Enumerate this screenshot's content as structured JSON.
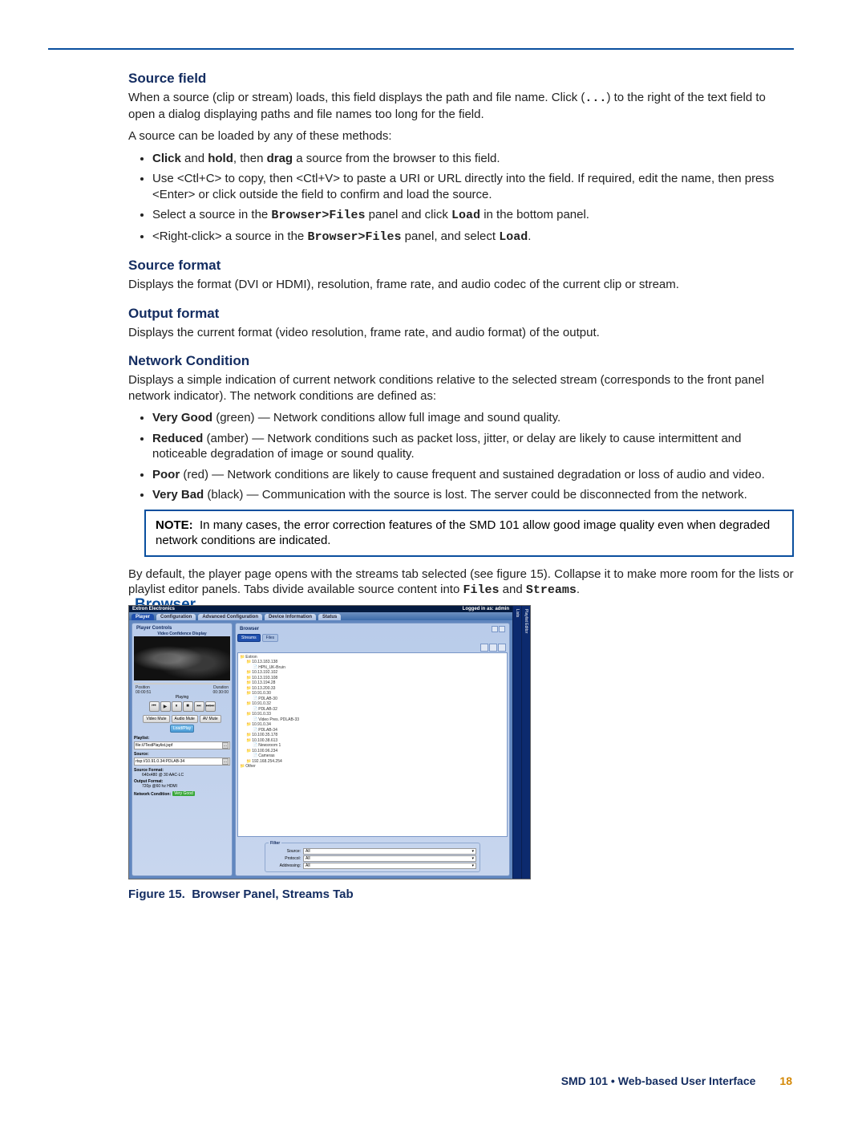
{
  "sections": {
    "source_field": {
      "title": "Source field",
      "p1a": "When a source (clip or stream) loads, this field displays the path and file name. Click (",
      "p1b": ") to the right of the text field to open a dialog displaying paths and file names too long for the field.",
      "dots": "...",
      "p2": "A source can be loaded by any of these methods:",
      "bullets": [
        {
          "b1": "Click",
          "mid1": " and ",
          "b2": "hold",
          "mid2": ", then ",
          "b3": "drag",
          "rest": " a source from the browser to this field."
        },
        {
          "text": "Use <Ctl+C> to copy, then <Ctl+V> to paste a URI or URL directly into the field. If required, edit the name, then press <Enter> or click outside the field to confirm and load the source."
        },
        {
          "pre": "Select a source in the ",
          "code": "Browser>Files",
          "mid": " panel and click ",
          "code2": "Load",
          "post": " in the bottom panel."
        },
        {
          "pre": "<Right-click> a source in the ",
          "code": "Browser>Files",
          "mid": " panel, and select ",
          "code2": "Load",
          "post": "."
        }
      ]
    },
    "source_format": {
      "title": "Source format",
      "body": "Displays the format (DVI or HDMI), resolution, frame rate, and audio codec of the current clip or stream."
    },
    "output_format": {
      "title": "Output format",
      "body": "Displays the current format (video resolution, frame rate, and audio format) of the output."
    },
    "network_condition": {
      "title": "Network Condition",
      "body": "Displays a simple indication of current network conditions relative to the selected stream (corresponds to the front panel network indicator). The network conditions are defined as:",
      "bullets": [
        {
          "b": "Very Good",
          "rest": " (green) — Network conditions allow full image and sound quality."
        },
        {
          "b": "Reduced",
          "rest": " (amber) — Network conditions such as packet loss, jitter, or delay are likely to cause intermittent and noticeable degradation of image or sound quality."
        },
        {
          "b": "Poor",
          "rest": " (red) — Network conditions are likely to cause frequent and sustained degradation or loss of audio and video."
        },
        {
          "b": "Very Bad",
          "rest": " (black) — Communication with the source is lost. The server could be disconnected from the network."
        }
      ],
      "note_label": "NOTE:",
      "note_body": "In many cases, the error correction features of the SMD 101 allow good image quality even when degraded network conditions are indicated."
    },
    "browser": {
      "title": "Browser",
      "p_pre": "By default, the player page opens with the streams tab selected (see figure 15). Collapse it to make more room for the lists or playlist editor panels. Tabs divide available source content into ",
      "code1": "Files",
      "and": " and ",
      "code2": "Streams",
      "post": "."
    }
  },
  "figure": {
    "caption_num": "Figure 15.",
    "caption_text": "Browser Panel, Streams Tab"
  },
  "footer": {
    "text": "SMD 101 • Web-based User Interface",
    "page": "18"
  },
  "screenshot": {
    "brand": "Extron Electronics",
    "login": "Logged in as: admin",
    "tabs": [
      "Player",
      "Configuration",
      "Advanced Configuration",
      "Device Information",
      "Status"
    ],
    "active_tab": "Player",
    "left": {
      "title": "Player Controls",
      "subtitle": "Video Confidence Display",
      "position_label": "Position",
      "position": "00:00:51",
      "duration_label": "Duration",
      "duration": "00:30:00",
      "status": "Playing",
      "controls": [
        "⏮",
        "▶",
        "⏸",
        "■",
        "⏭",
        "⏭⏭"
      ],
      "btn_video_mute": "Video Mute",
      "btn_audio_mute": "Audio Mute",
      "btn_av_mute": "AV Mute",
      "btn_load_play": "Load/Play",
      "playlist_label": "Playlist:",
      "playlist_value": "file:///TestPlaylist.jspf",
      "source_label": "Source:",
      "source_value": "rtsp://10.91.0.34:PDLAB-34",
      "source_format_label": "Source Format:",
      "source_format_value": "640x480 @ 30 AAC-LC",
      "output_format_label": "Output Format:",
      "output_format_value": "720p @60 hz HDMI",
      "nc_label": "Network Condition:",
      "nc_value": "Very Good"
    },
    "browser": {
      "title": "Browser",
      "subtabs_streams": "Streams",
      "subtabs_files": "Files",
      "tree": [
        {
          "cls": "fld",
          "ind": 0,
          "t": "Extron"
        },
        {
          "cls": "fld",
          "ind": 1,
          "t": "10.13.183.138"
        },
        {
          "cls": "file",
          "ind": 2,
          "t": "HPN_UK-Bruin"
        },
        {
          "cls": "fld",
          "ind": 1,
          "t": "10.13.192.102"
        },
        {
          "cls": "fld",
          "ind": 1,
          "t": "10.13.193.108"
        },
        {
          "cls": "fld",
          "ind": 1,
          "t": "10.13.194.28"
        },
        {
          "cls": "fld",
          "ind": 1,
          "t": "10.13.200.33"
        },
        {
          "cls": "fld",
          "ind": 1,
          "t": "10.91.0.30"
        },
        {
          "cls": "file",
          "ind": 2,
          "t": "PDLAB-30"
        },
        {
          "cls": "fld",
          "ind": 1,
          "t": "10.91.0.32"
        },
        {
          "cls": "file",
          "ind": 2,
          "t": "PDLAB-32"
        },
        {
          "cls": "fld",
          "ind": 1,
          "t": "10.91.0.33"
        },
        {
          "cls": "file",
          "ind": 2,
          "t": "Video Pres. PDLAB-33"
        },
        {
          "cls": "fld",
          "ind": 1,
          "t": "10.91.0.34"
        },
        {
          "cls": "file",
          "ind": 2,
          "t": "PDLAB-34"
        },
        {
          "cls": "fld",
          "ind": 1,
          "t": "10.100.35.178"
        },
        {
          "cls": "fld",
          "ind": 1,
          "t": "10.100.38.613"
        },
        {
          "cls": "file",
          "ind": 2,
          "t": "Newsroom 1"
        },
        {
          "cls": "fld",
          "ind": 1,
          "t": "10.100.96.234"
        },
        {
          "cls": "file",
          "ind": 2,
          "t": "Cameras"
        },
        {
          "cls": "fld",
          "ind": 1,
          "t": "192.168.254.254"
        },
        {
          "cls": "fld",
          "ind": 0,
          "t": "Other"
        }
      ],
      "filter": {
        "legend": "Filter",
        "source_label": "Source:",
        "protocol_label": "Protocol:",
        "addressing_label": "Addressing:",
        "value": "All"
      }
    },
    "side1": "Lists",
    "side2": "Playlist Editor"
  }
}
